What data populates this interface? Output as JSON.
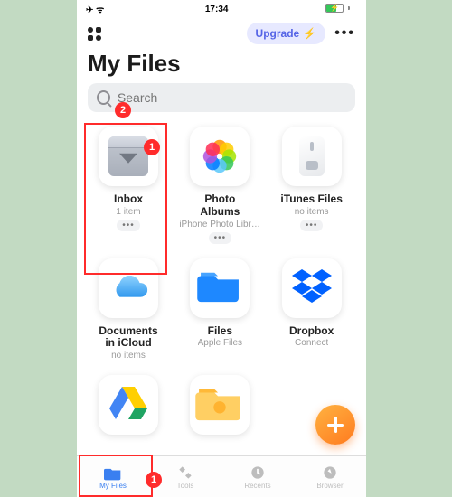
{
  "status": {
    "time": "17:34",
    "icons_left": "✈ ᯤ",
    "battery_charging": true
  },
  "header": {
    "upgrade_label": "Upgrade"
  },
  "page": {
    "title": "My Files"
  },
  "search": {
    "placeholder": "Search"
  },
  "tiles": [
    {
      "name": "Inbox",
      "sub": "1 item",
      "more": true,
      "icon": "inbox"
    },
    {
      "name": "Photo\nAlbums",
      "sub": "iPhone Photo Libra…",
      "more": true,
      "icon": "photos"
    },
    {
      "name": "iTunes Files",
      "sub": "no items",
      "more": true,
      "icon": "itunes"
    },
    {
      "name": "Documents\nin iCloud",
      "sub": "no items",
      "more": false,
      "icon": "cloud"
    },
    {
      "name": "Files",
      "sub": "Apple Files",
      "more": false,
      "icon": "files"
    },
    {
      "name": "Dropbox",
      "sub": "Connect",
      "more": false,
      "icon": "dropbox"
    },
    {
      "name": "",
      "sub": "",
      "more": false,
      "icon": "drive"
    },
    {
      "name": "",
      "sub": "",
      "more": false,
      "icon": "folder"
    }
  ],
  "tabs": [
    {
      "label": "My Files",
      "active": true
    },
    {
      "label": "Tools",
      "active": false
    },
    {
      "label": "Recents",
      "active": false
    },
    {
      "label": "Browser",
      "active": false
    }
  ],
  "annotations": {
    "tab_callout": "1",
    "tile_callout": "1",
    "search_callout": "2"
  }
}
